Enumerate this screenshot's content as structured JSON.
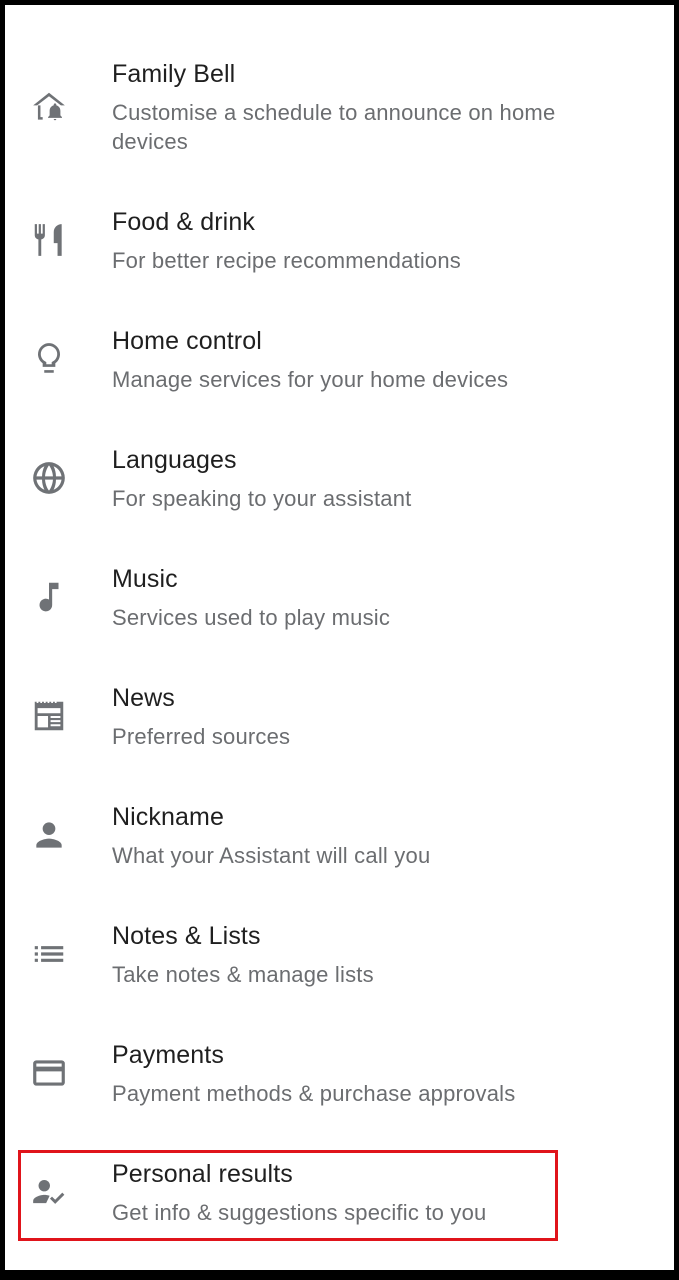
{
  "settings_list": {
    "items": [
      {
        "icon": "family-bell-icon",
        "title": "Family Bell",
        "subtitle": "Customise a schedule to announce on home devices"
      },
      {
        "icon": "food-drink-icon",
        "title": "Food & drink",
        "subtitle": "For better recipe recommendations"
      },
      {
        "icon": "lightbulb-icon",
        "title": "Home control",
        "subtitle": "Manage services for your home devices"
      },
      {
        "icon": "globe-icon",
        "title": "Languages",
        "subtitle": "For speaking to your assistant"
      },
      {
        "icon": "music-note-icon",
        "title": "Music",
        "subtitle": "Services used to play music"
      },
      {
        "icon": "newspaper-icon",
        "title": "News",
        "subtitle": "Preferred sources"
      },
      {
        "icon": "person-icon",
        "title": "Nickname",
        "subtitle": "What your Assistant will call you"
      },
      {
        "icon": "list-icon",
        "title": "Notes & Lists",
        "subtitle": "Take notes & manage lists"
      },
      {
        "icon": "credit-card-icon",
        "title": "Payments",
        "subtitle": "Payment methods & purchase approvals"
      },
      {
        "icon": "personal-results-icon",
        "title": "Personal results",
        "subtitle": "Get info & suggestions specific to you"
      }
    ],
    "highlighted_item": "Personal results",
    "highlight_color": "#e0141b"
  }
}
